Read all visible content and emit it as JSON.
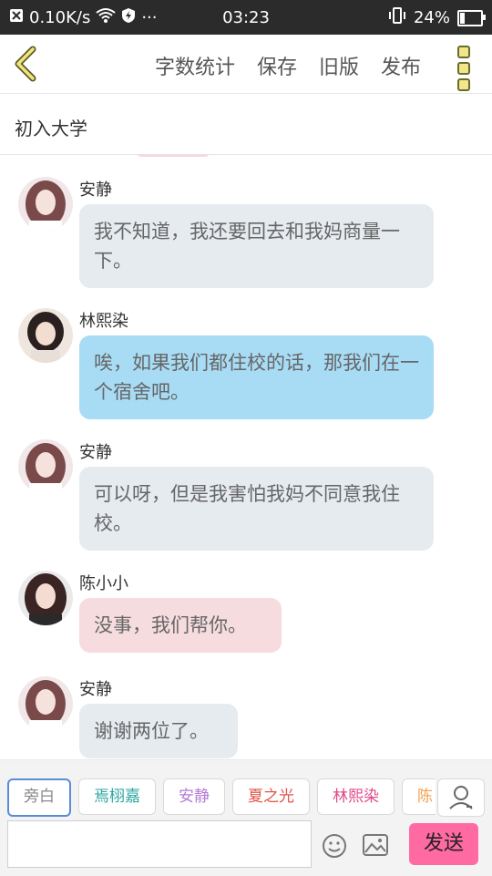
{
  "status_bar": {
    "network_speed": "0.10K/s",
    "time": "03:23",
    "battery": "24%",
    "battery_level": 0.24,
    "more": "···"
  },
  "toolbar": {
    "word_count": "字数统计",
    "save": "保存",
    "old_version": "旧版",
    "publish": "发布"
  },
  "chapter": {
    "title": "初入大学"
  },
  "messages": [
    {
      "speaker": "安静",
      "text": "我不知道，我还要回去和我妈商量一下。",
      "bubble_color": "#e6ebf0"
    },
    {
      "speaker": "林熙染",
      "text": "唉，如果我们都住校的话，那我们在一个宿舍吧。",
      "bubble_color": "#a8dcf5"
    },
    {
      "speaker": "安静",
      "text": "可以呀，但是我害怕我妈不同意我住校。",
      "bubble_color": "#e6ebf0"
    },
    {
      "speaker": "陈小小",
      "text": "没事，我们帮你。",
      "bubble_color": "#f6dcdf"
    },
    {
      "speaker": "安静",
      "text": "谢谢两位了。",
      "bubble_color": "#e6ebf0"
    }
  ],
  "roles": [
    {
      "label": "旁白",
      "color": "#888888"
    },
    {
      "label": "焉栩嘉",
      "color": "#2aa6a0"
    },
    {
      "label": "安静",
      "color": "#b47ad6"
    },
    {
      "label": "夏之光",
      "color": "#e0564a"
    },
    {
      "label": "林熙染",
      "color": "#e04a8a"
    },
    {
      "label": "陈",
      "color": "#f0a050"
    }
  ],
  "composer": {
    "input_value": "",
    "send": "发送"
  },
  "icons": {
    "back": "chevron-left-icon",
    "more": "more-vertical-icon",
    "emoji": "emoji-icon",
    "image": "image-icon",
    "role_manager": "person-icon"
  }
}
